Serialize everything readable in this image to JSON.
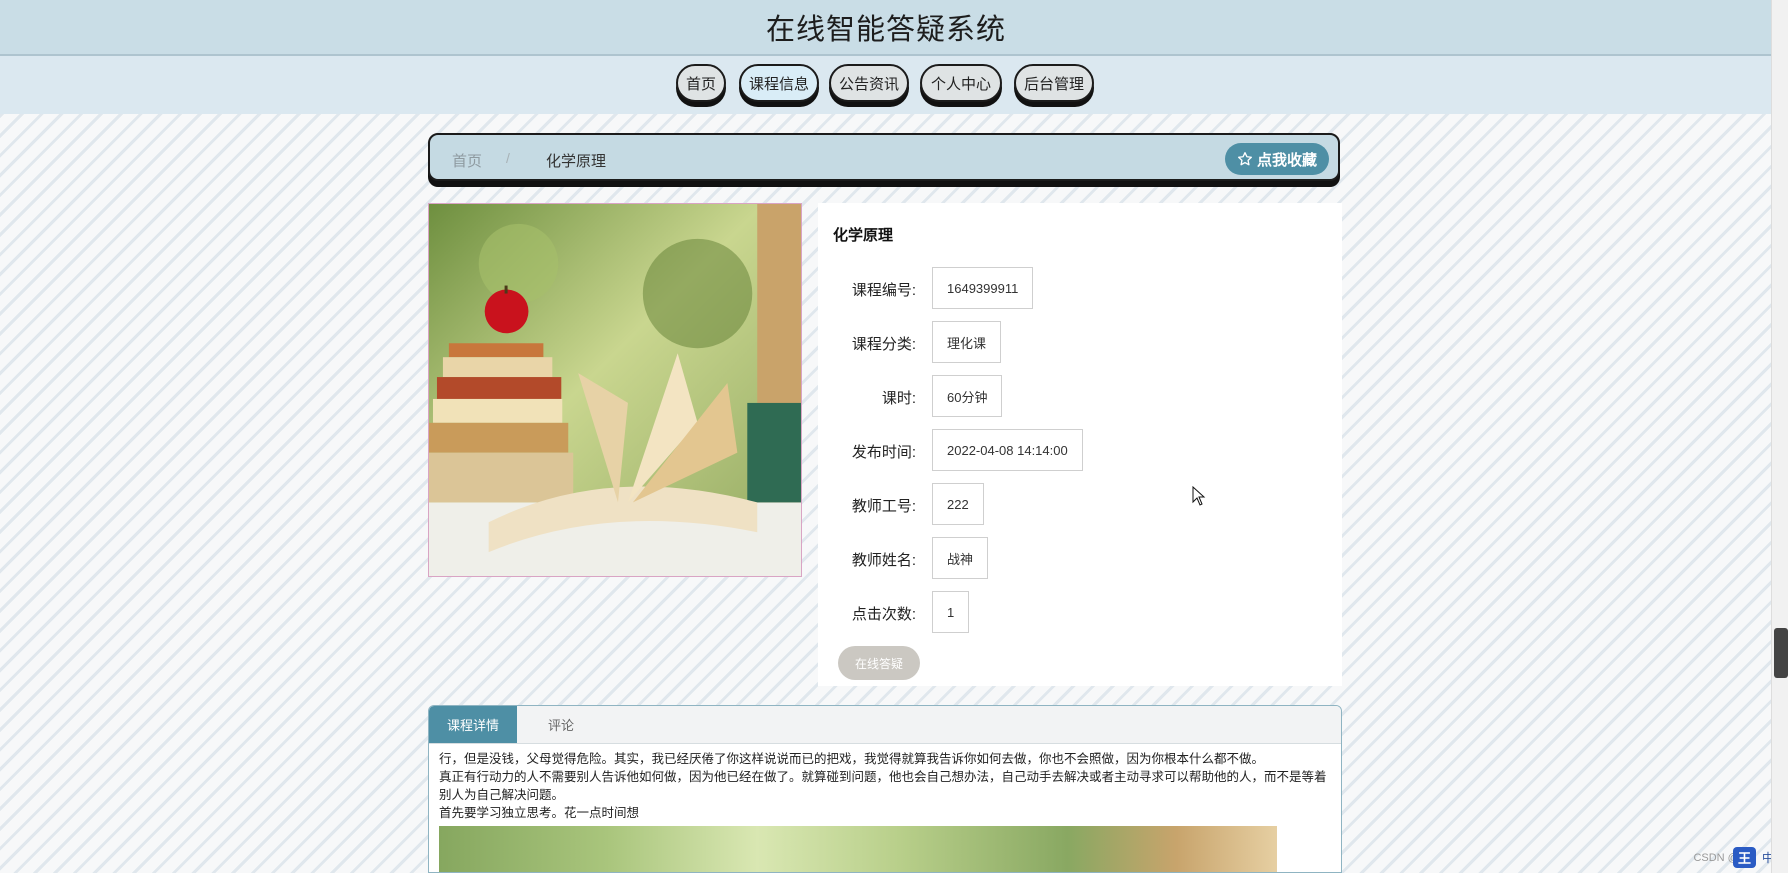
{
  "site": {
    "title": "在线智能答疑系统"
  },
  "nav": {
    "items": [
      {
        "label": "首页"
      },
      {
        "label": "课程信息"
      },
      {
        "label": "公告资讯"
      },
      {
        "label": "个人中心"
      },
      {
        "label": "后台管理"
      }
    ]
  },
  "breadcrumb": {
    "home": "首页",
    "separator": "/",
    "current": "化学原理"
  },
  "favorite_button": {
    "label": "点我收藏",
    "icon": "star-outline-icon"
  },
  "course": {
    "title": "化学原理",
    "fields": [
      {
        "label": "课程编号:",
        "value": "1649399911"
      },
      {
        "label": "课程分类:",
        "value": "理化课"
      },
      {
        "label": "课时:",
        "value": "60分钟"
      },
      {
        "label": "发布时间:",
        "value": "2022-04-08 14:14:00"
      },
      {
        "label": "教师工号:",
        "value": "222"
      },
      {
        "label": "教师姓名:",
        "value": "战神"
      },
      {
        "label": "点击次数:",
        "value": "1"
      }
    ],
    "qa_button": "在线答疑"
  },
  "tabs": {
    "items": [
      {
        "label": "课程详情"
      },
      {
        "label": "评论"
      }
    ],
    "detail_lines": [
      "行，但是没钱，父母觉得危险。其实，我已经厌倦了你这样说说而已的把戏，我觉得就算我告诉你如何去做，你也不会照做，因为你根本什么都不做。",
      "真正有行动力的人不需要别人告诉他如何做，因为他已经在做了。就算碰到问题，他也会自己想办法，自己动手去解决或者主动寻求可以帮助他的人，而不是等着别人为自己解决问题。",
      "首先要学习独立思考。花一点时间想"
    ]
  },
  "ime": {
    "badge": "王",
    "label": "中"
  },
  "watermark": "CSDN @..."
}
